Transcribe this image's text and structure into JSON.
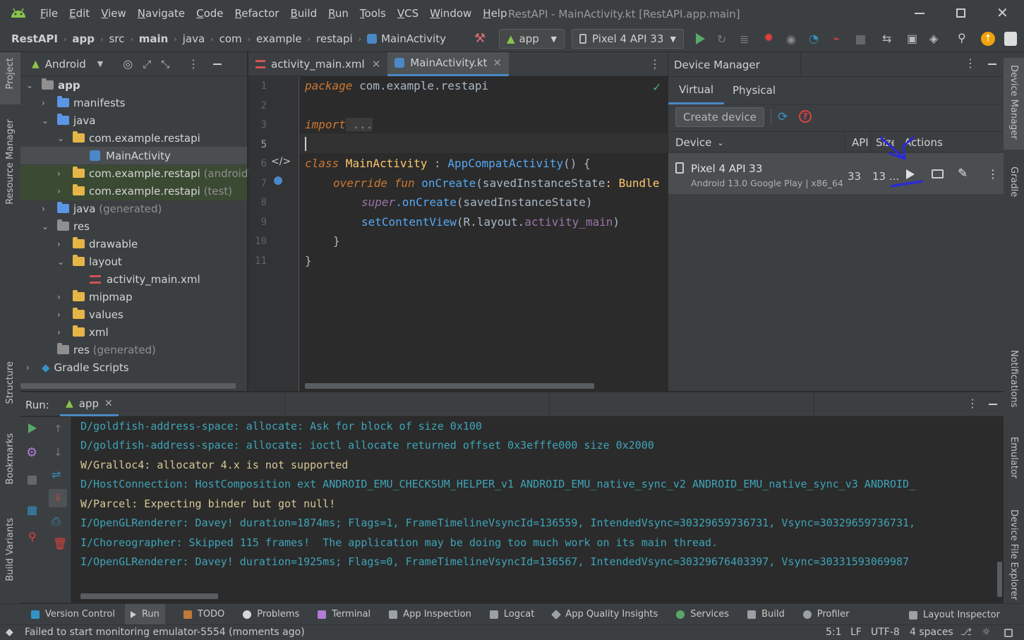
{
  "window": {
    "title": "RestAPI - MainActivity.kt [RestAPI.app.main]",
    "menu": [
      "File",
      "Edit",
      "View",
      "Navigate",
      "Code",
      "Refactor",
      "Build",
      "Run",
      "Tools",
      "VCS",
      "Window",
      "Help"
    ]
  },
  "breadcrumb": [
    "RestAPI",
    "app",
    "src",
    "main",
    "java",
    "com",
    "example",
    "restapi",
    "MainActivity"
  ],
  "run_config": {
    "module": "app",
    "device": "Pixel 4 API 33"
  },
  "left_strip": {
    "project": "Project",
    "resource_manager": "Resource Manager",
    "structure": "Structure",
    "bookmarks": "Bookmarks",
    "build_variants": "Build Variants"
  },
  "right_strip": {
    "device_manager": "Device Manager",
    "gradle": "Gradle",
    "notifications": "Notifications",
    "emulator": "Emulator",
    "device_file_explorer": "Device File Explorer"
  },
  "project": {
    "view": "Android",
    "tree": [
      {
        "label": "app",
        "extra": ""
      },
      {
        "label": "manifests",
        "extra": ""
      },
      {
        "label": "java",
        "extra": ""
      },
      {
        "label": "com.example.restapi",
        "extra": ""
      },
      {
        "label": "MainActivity",
        "extra": ""
      },
      {
        "label": "com.example.restapi",
        "extra": "(androidTes"
      },
      {
        "label": "com.example.restapi",
        "extra": "(test)"
      },
      {
        "label": "java",
        "extra": "(generated)"
      },
      {
        "label": "res",
        "extra": ""
      },
      {
        "label": "drawable",
        "extra": ""
      },
      {
        "label": "layout",
        "extra": ""
      },
      {
        "label": "activity_main.xml",
        "extra": ""
      },
      {
        "label": "mipmap",
        "extra": ""
      },
      {
        "label": "values",
        "extra": ""
      },
      {
        "label": "xml",
        "extra": ""
      },
      {
        "label": "res",
        "extra": "(generated)"
      },
      {
        "label": "Gradle Scripts",
        "extra": ""
      }
    ]
  },
  "editor": {
    "tabs": [
      "activity_main.xml",
      "MainActivity.kt"
    ],
    "line_numbers": [
      "1",
      "2",
      "3",
      "5",
      "6",
      "7",
      "8",
      "9",
      "10",
      "11"
    ],
    "code": {
      "l1_kw": "package",
      "l1_rest": " com.example.restapi",
      "l3_kw": "import",
      "l3_rest": " ...",
      "l6_kw": "class",
      "l6_name": " MainActivity",
      "l6_colon": " : ",
      "l6_parent": "AppCompatActivity",
      "l6_end": "() {",
      "l7_kw1": "override",
      "l7_kw2": " fun",
      "l7_fn": " onCreate",
      "l7_param": "(savedInstanceState",
      "l7_end": ": Bundle",
      "l8_super": "super",
      "l8_call": ".onCreate",
      "l8_end": "(savedInstanceState)",
      "l9_fn": "setContentView",
      "l9_mid": "(R.layout.",
      "l9_id": "activity_main",
      "l9_end": ")",
      "l10": "}",
      "l11": "}"
    }
  },
  "device_manager": {
    "title": "Device Manager",
    "tabs": [
      "Virtual",
      "Physical"
    ],
    "create_button": "Create device",
    "columns": {
      "device": "Device",
      "api": "API",
      "size": "Size",
      "actions": "Actions"
    },
    "device": {
      "name": "Pixel 4 API 33",
      "detail": "Android 13.0 Google Play | x86_64",
      "api": "33",
      "size": "13 ..."
    }
  },
  "run": {
    "label": "Run:",
    "tab": "app",
    "log": [
      "D/goldfish-address-space: allocate: Ask for block of size 0x100",
      "D/goldfish-address-space: allocate: ioctl allocate returned offset 0x3efffe000 size 0x2000",
      "W/Gralloc4: allocator 4.x is not supported",
      "D/HostConnection: HostComposition ext ANDROID_EMU_CHECKSUM_HELPER_v1 ANDROID_EMU_native_sync_v2 ANDROID_EMU_native_sync_v3 ANDROID_",
      "W/Parcel: Expecting binder but got null!",
      "I/OpenGLRenderer: Davey! duration=1874ms; Flags=1, FrameTimelineVsyncId=136559, IntendedVsync=30329659736731, Vsync=30329659736731,",
      "I/Choreographer: Skipped 115 frames!  The application may be doing too much work on its main thread.",
      "I/OpenGLRenderer: Davey! duration=1925ms; Flags=0, FrameTimelineVsyncId=136567, IntendedVsync=30329676403397, Vsync=30331593069987"
    ]
  },
  "tool_windows": [
    "Version Control",
    "Run",
    "TODO",
    "Problems",
    "Terminal",
    "App Inspection",
    "Logcat",
    "App Quality Insights",
    "Services",
    "Build",
    "Profiler",
    "Layout Inspector"
  ],
  "status": {
    "message": "Failed to start monitoring emulator-5554 (moments ago)",
    "position": "5:1",
    "line_sep": "LF",
    "encoding": "UTF-8",
    "indent": "4 spaces"
  },
  "colors": {
    "accent": "#4a88c7",
    "run_green": "#59a869",
    "android_green": "#8bc34a",
    "log_debug": "#3ea4b8",
    "log_warn": "#d8c896",
    "annotation": "#2a2ad8"
  }
}
